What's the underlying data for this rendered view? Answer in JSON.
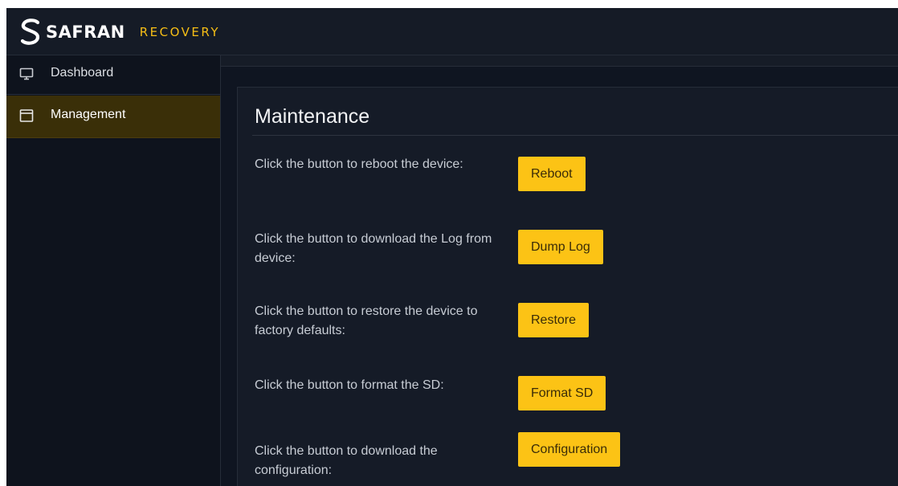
{
  "header": {
    "brand": "SAFRAN",
    "product": "RECOVERY",
    "accent_color": "#f6be16"
  },
  "sidebar": {
    "items": [
      {
        "label": "Dashboard",
        "icon": "monitor-icon",
        "active": false
      },
      {
        "label": "Management",
        "icon": "window-icon",
        "active": true
      }
    ]
  },
  "main": {
    "title": "Maintenance",
    "rows": [
      {
        "text": "Click the button to reboot the device:",
        "button": "Reboot"
      },
      {
        "text": "Click the button to download the Log from device:",
        "button": "Dump Log"
      },
      {
        "text": "Click the button to restore the device to factory defaults:",
        "button": "Restore"
      },
      {
        "text": "Click the button to format the SD:",
        "button": "Format SD"
      },
      {
        "text": "Click the button to download the configuration:",
        "button": "Configuration"
      }
    ]
  },
  "colors": {
    "background": "#0f1521",
    "button": "#fcc315",
    "active_nav": "#3a2f08"
  }
}
